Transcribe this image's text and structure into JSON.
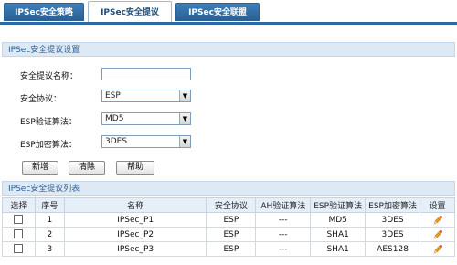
{
  "tabs": [
    {
      "label": "IPSec安全策略"
    },
    {
      "label": "IPSec安全提议"
    },
    {
      "label": "IPSec安全联盟"
    }
  ],
  "settings": {
    "header": "IPSec安全提议设置",
    "name_label": "安全提议名称：",
    "name_value": "",
    "protocol_label": "安全协议：",
    "protocol_value": "ESP",
    "auth_label": "ESP验证算法：",
    "auth_value": "MD5",
    "enc_label": "ESP加密算法：",
    "enc_value": "3DES"
  },
  "buttons": {
    "add": "新增",
    "clear": "清除",
    "help": "帮助"
  },
  "list": {
    "header": "IPSec安全提议列表",
    "columns": [
      "选择",
      "序号",
      "名称",
      "安全协议",
      "AH验证算法",
      "ESP验证算法",
      "ESP加密算法",
      "设置"
    ],
    "rows": [
      {
        "index": "1",
        "name": "IPSec_P1",
        "protocol": "ESP",
        "ah": "---",
        "esp_auth": "MD5",
        "esp_enc": "3DES"
      },
      {
        "index": "2",
        "name": "IPSec_P2",
        "protocol": "ESP",
        "ah": "---",
        "esp_auth": "SHA1",
        "esp_enc": "3DES"
      },
      {
        "index": "3",
        "name": "IPSec_P3",
        "protocol": "ESP",
        "ah": "---",
        "esp_auth": "SHA1",
        "esp_enc": "AES128"
      }
    ]
  },
  "colors": {
    "accent": "#2c6aa5",
    "header_bg": "#dfe9f4",
    "edit_icon": "#f0a020"
  },
  "icons": {
    "row_action": "pencil-icon",
    "dropdown": "chevron-down-icon"
  }
}
